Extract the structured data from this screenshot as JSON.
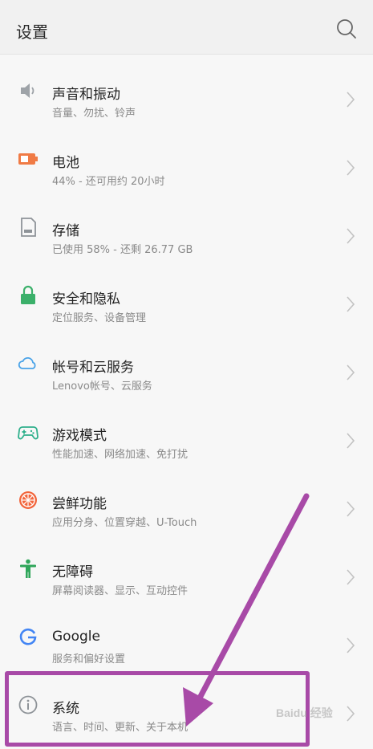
{
  "header": {
    "title": "设置",
    "search_icon": "search-icon"
  },
  "settings": [
    {
      "title": "声音和振动",
      "subtitle": "音量、勿扰、铃声",
      "icon": "speaker-icon",
      "color": "#9ea3a8"
    },
    {
      "title": "电池",
      "subtitle": "44% - 还可用约 20小时",
      "icon": "battery-icon",
      "color": "#f07b45"
    },
    {
      "title": "存储",
      "subtitle": "已使用 58% - 还剩 26.77 GB",
      "icon": "storage-card-icon",
      "color": "#8e9398"
    },
    {
      "title": "安全和隐私",
      "subtitle": "定位服务、设备管理",
      "icon": "lock-icon",
      "color": "#3bb06a"
    },
    {
      "title": "帐号和云服务",
      "subtitle": "Lenovo帐号、云服务",
      "icon": "cloud-icon",
      "color": "#4aa3e8"
    },
    {
      "title": "游戏模式",
      "subtitle": "性能加速、网络加速、免打扰",
      "icon": "gamepad-icon",
      "color": "#2fb08c"
    },
    {
      "title": "尝鲜功能",
      "subtitle": "应用分身、位置穿越、U-Touch",
      "icon": "orange-slice-icon",
      "color": "#f2653c"
    },
    {
      "title": "无障碍",
      "subtitle": "屏幕阅读器、显示、互动控件",
      "icon": "accessibility-person-icon",
      "color": "#2fa65a"
    },
    {
      "title": "Google",
      "subtitle": "服务和偏好设置",
      "icon": "google-g-icon",
      "color": "#4285f4"
    },
    {
      "title": "系统",
      "subtitle": "语言、时间、更新、关于本机",
      "icon": "info-icon",
      "color": "#8e9398"
    }
  ],
  "annotation": {
    "highlight_color": "#a84aa7",
    "watermark": "Baidu 经验"
  }
}
